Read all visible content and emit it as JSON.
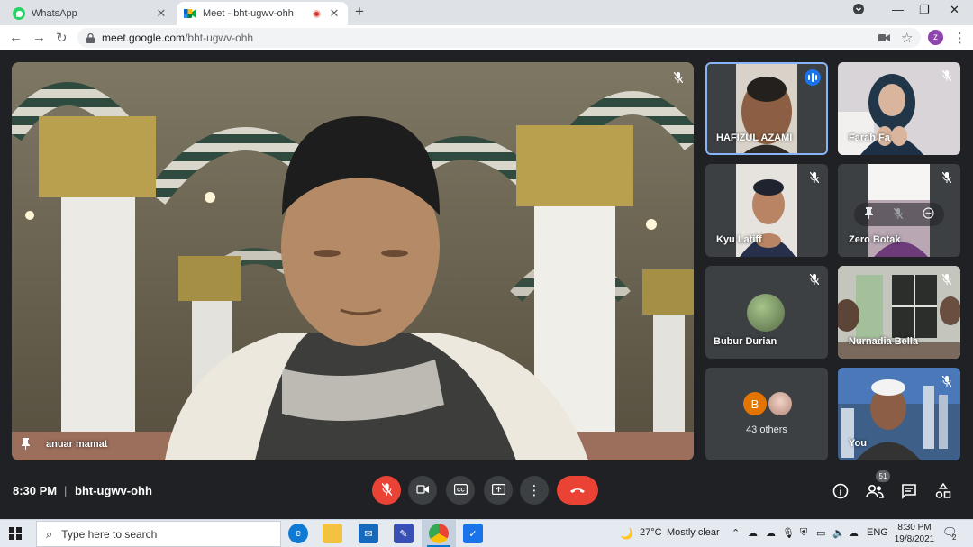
{
  "browser": {
    "tabs": [
      {
        "title": "WhatsApp",
        "active": false
      },
      {
        "title": "Meet - bht-ugwv-ohh",
        "active": true
      }
    ],
    "url_domain": "meet.google.com",
    "url_path": "/bht-ugwv-ohh",
    "profile_initial": "z"
  },
  "meet": {
    "main_speaker": "anuar mamat",
    "participants": [
      {
        "name": "HAFIZUL AZAMI",
        "speaking": true
      },
      {
        "name": "Farah Fa",
        "muted": true
      },
      {
        "name": "Kyu Latiff",
        "muted": true
      },
      {
        "name": "Zero Botak",
        "muted": true
      },
      {
        "name": "Bubur Durian",
        "muted": true
      },
      {
        "name": "Nurnadia Bella",
        "muted": true
      },
      {
        "name": "You",
        "muted": true
      }
    ],
    "others_initial": "B",
    "others_label": "43 others",
    "time": "8:30 PM",
    "separator": "|",
    "code": "bht-ugwv-ohh",
    "participant_count": "51",
    "colors": {
      "accent": "#8ab4f8",
      "mic_off": "#ea4335",
      "hangup": "#ea4335",
      "speaking": "#1a73e8"
    }
  },
  "taskbar": {
    "search_placeholder": "Type here to search",
    "weather_temp": "27°C",
    "weather_desc": "Mostly clear",
    "lang": "ENG",
    "clock_time": "8:30 PM",
    "clock_date": "19/8/2021",
    "notification_count": "2"
  }
}
